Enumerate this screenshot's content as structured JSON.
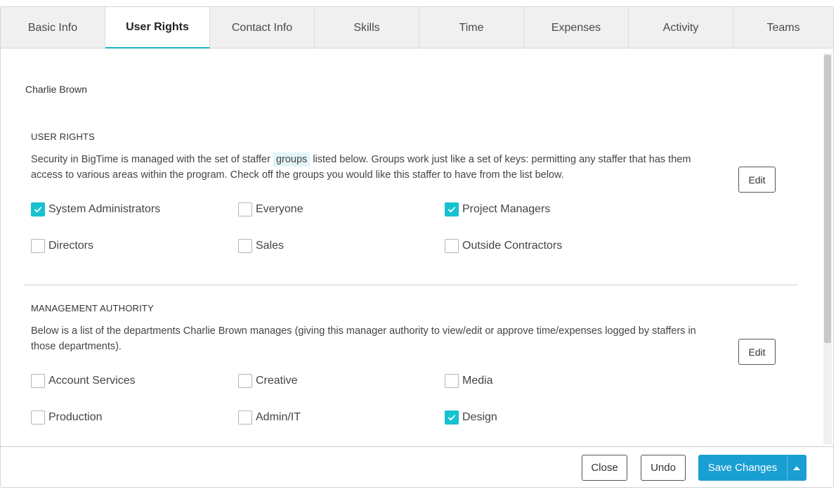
{
  "tabs": [
    {
      "label": "Basic Info",
      "active": false
    },
    {
      "label": "User Rights",
      "active": true
    },
    {
      "label": "Contact Info",
      "active": false
    },
    {
      "label": "Skills",
      "active": false
    },
    {
      "label": "Time",
      "active": false
    },
    {
      "label": "Expenses",
      "active": false
    },
    {
      "label": "Activity",
      "active": false
    },
    {
      "label": "Teams",
      "active": false
    }
  ],
  "person_name": "Charlie Brown",
  "user_rights": {
    "title": "USER RIGHTS",
    "desc_before": "Security in BigTime is managed with the set of staffer",
    "desc_highlight": "groups",
    "desc_after": "listed below. Groups work just like a set of keys: permitting any staffer that has them access to various areas within the program. Check off the groups you would like this staffer to have from the list below.",
    "edit_label": "Edit",
    "groups": [
      {
        "label": "System Administrators",
        "checked": true
      },
      {
        "label": "Everyone",
        "checked": false
      },
      {
        "label": "Project Managers",
        "checked": true
      },
      {
        "label": "Directors",
        "checked": false
      },
      {
        "label": "Sales",
        "checked": false
      },
      {
        "label": "Outside Contractors",
        "checked": false
      }
    ]
  },
  "management_authority": {
    "title": "MANAGEMENT AUTHORITY",
    "desc": "Below is a list of the departments Charlie Brown manages (giving this manager authority to view/edit or approve time/expenses logged by staffers in those departments).",
    "edit_label": "Edit",
    "departments": [
      {
        "label": "Account Services",
        "checked": false
      },
      {
        "label": "Creative",
        "checked": false
      },
      {
        "label": "Media",
        "checked": false
      },
      {
        "label": "Production",
        "checked": false
      },
      {
        "label": "Admin/IT",
        "checked": false
      },
      {
        "label": "Design",
        "checked": true
      }
    ]
  },
  "footer": {
    "close_label": "Close",
    "undo_label": "Undo",
    "save_label": "Save Changes",
    "caret_icon": "caret-up-icon"
  },
  "colors": {
    "accent": "#16c2cf",
    "primary_button": "#1a9fd2",
    "tab_underline": "#16b5c7"
  }
}
